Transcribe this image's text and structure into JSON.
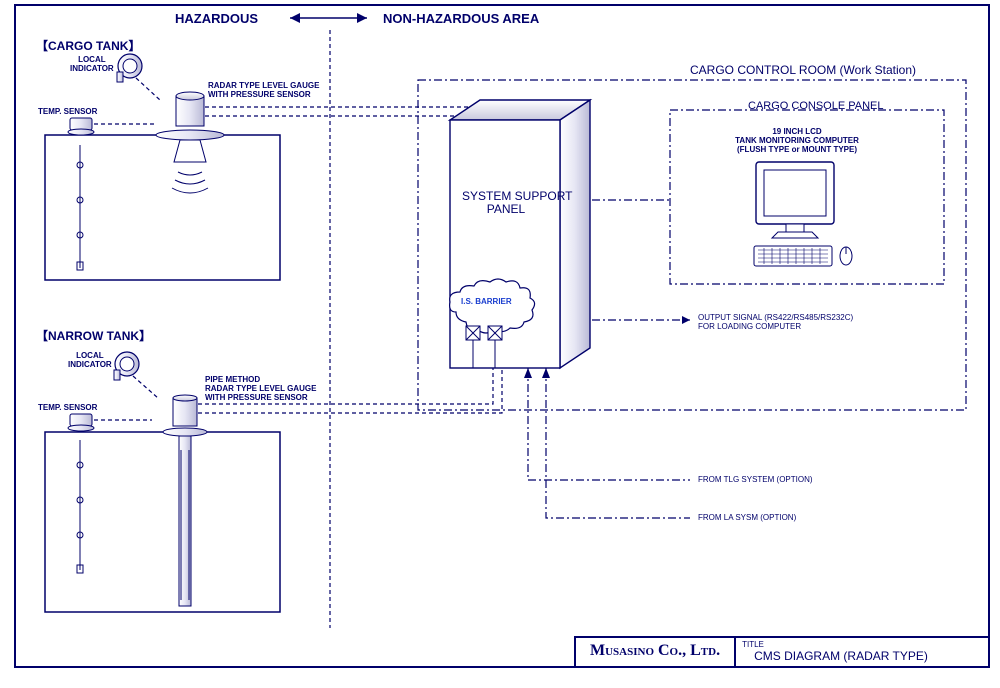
{
  "header": {
    "hazardous": "HAZARDOUS",
    "nonhazardous": "NON-HAZARDOUS AREA"
  },
  "cargo_tank": {
    "title": "【CARGO TANK】",
    "local_indicator": "LOCAL\nINDICATOR",
    "radar_label": "RADAR TYPE LEVEL GAUGE\nWITH PRESSURE SENSOR",
    "temp_sensor": "TEMP. SENSOR"
  },
  "narrow_tank": {
    "title": "【NARROW TANK】",
    "local_indicator": "LOCAL\nINDICATOR",
    "pipe_method": "PIPE METHOD\nRADAR TYPE LEVEL GAUGE\nWITH PRESSURE SENSOR",
    "temp_sensor": "TEMP. SENSOR"
  },
  "control_room": {
    "title": "CARGO CONTROL ROOM (Work Station)",
    "ssp": "SYSTEM SUPPORT\nPANEL",
    "is_barrier": "I.S. BARRIER",
    "console_title": "CARGO CONSOLE PANEL",
    "monitor_label": "19 INCH LCD\nTANK MONITORING COMPUTER\n(FLUSH TYPE or MOUNT TYPE)",
    "output_signal": "OUTPUT SIGNAL (RS422/RS485/RS232C)\nFOR LOADING COMPUTER"
  },
  "options": {
    "tlg": "FROM TLG SYSTEM (OPTION)",
    "la": "FROM LA SYSM (OPTION)"
  },
  "footer": {
    "company": "Musasino Co., Ltd.",
    "title_label": "TITLE",
    "title": "CMS DIAGRAM (RADAR TYPE)"
  }
}
